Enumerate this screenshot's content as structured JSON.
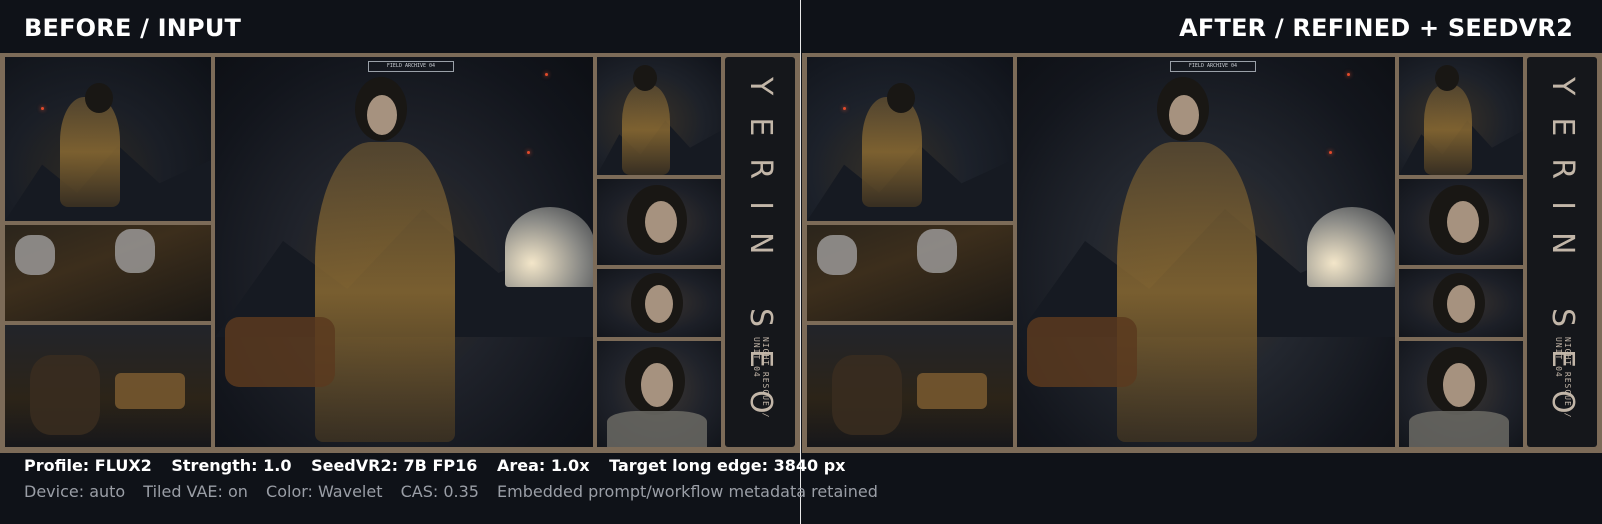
{
  "titles": {
    "before": "BEFORE / INPUT",
    "after": "AFTER / REFINED + SEEDVR2"
  },
  "poster": {
    "archive_label": "FIELD ARCHIVE 04",
    "name": "YERIN SEO",
    "subtitle": "NIGHT RESCUE / UNIT 04"
  },
  "params": [
    "Profile: FLUX2",
    "Strength: 1.0",
    "SeedVR2: 7B FP16",
    "Area: 1.0x",
    "Target long edge: 3840 px"
  ],
  "meta": [
    "Device: auto",
    "Tiled VAE: on",
    "Color: Wavelet",
    "CAS: 0.35",
    "Embedded prompt/workflow metadata retained"
  ],
  "colors": {
    "background": "#0f1218",
    "frame": "#7c6b58",
    "accent_light": "#e24a2a"
  }
}
